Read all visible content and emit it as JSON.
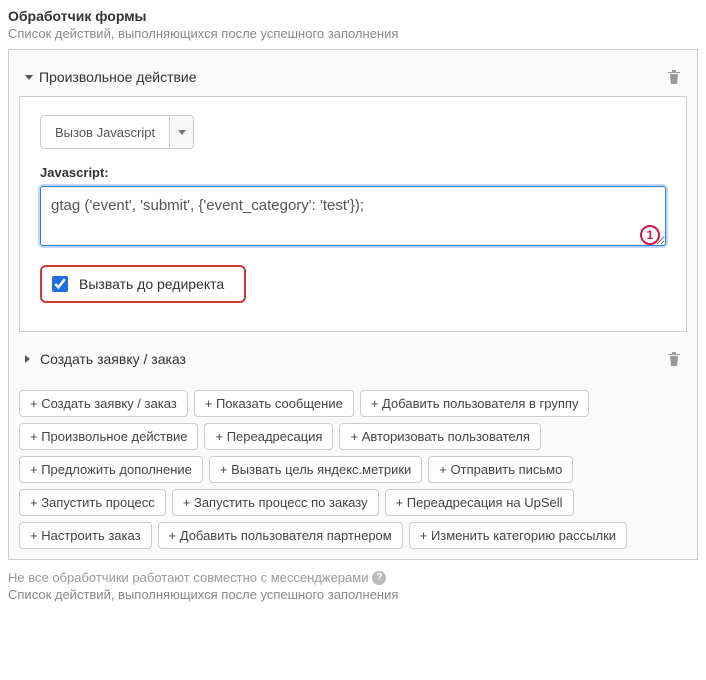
{
  "header": {
    "title": "Обработчик формы",
    "subtitle": "Список действий, выполняющихся после успешного заполнения"
  },
  "action_expanded": {
    "title": "Произвольное действие",
    "select_value": "Вызов Javascript",
    "field_label": "Javascript:",
    "code_value": "gtag ('event', 'submit', {'event_category': 'test'});",
    "badge": "1",
    "checkbox_label": "Вызвать до редиректа",
    "checkbox_checked": true
  },
  "action_collapsed": {
    "title": "Создать заявку / заказ"
  },
  "tags": [
    "+ Создать заявку / заказ",
    "+ Показать сообщение",
    "+ Добавить пользователя в группу",
    "+ Произвольное действие",
    "+ Переадресация",
    "+ Авторизовать пользователя",
    "+ Предложить дополнение",
    "+ Вызвать цель яндекс.метрики",
    "+ Отправить письмо",
    "+ Запустить процесс",
    "+ Запустить процесс по заказу",
    "+ Переадресация на UpSell",
    "+ Настроить заказ",
    "+ Добавить пользователя партнером",
    "+ Изменить категорию рассылки"
  ],
  "footer": {
    "note1": "Не все обработчики работают совместно с мессенджерами",
    "note2": "Список действий, выполняющихся после успешного заполнения"
  }
}
